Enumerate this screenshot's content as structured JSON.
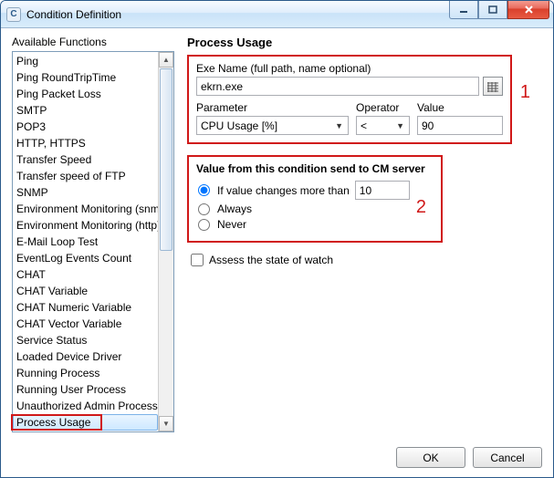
{
  "window": {
    "title": "Condition Definition",
    "icon_letter": "C"
  },
  "left": {
    "heading": "Available Functions",
    "items": [
      "Ping",
      "Ping RoundTripTime",
      "Ping Packet Loss",
      "SMTP",
      "POP3",
      "HTTP, HTTPS",
      "Transfer Speed",
      "Transfer speed of FTP",
      "SNMP",
      "Environment Monitoring (snmp)",
      "Environment Monitoring (http)",
      "E-Mail Loop Test",
      "EventLog Events Count",
      "CHAT",
      "CHAT Variable",
      "CHAT Numeric Variable",
      "CHAT Vector Variable",
      "Service Status",
      "Loaded Device Driver",
      "Running Process",
      "Running User Process",
      "Unauthorized Admin Process",
      "Process Usage"
    ],
    "selected_index": 22
  },
  "right": {
    "heading": "Process Usage",
    "box1": {
      "exe_label": "Exe Name (full path, name optional)",
      "exe_value": "ekrn.exe",
      "param_label": "Parameter",
      "param_value": "CPU Usage [%]",
      "op_label": "Operator",
      "op_value": "<",
      "value_label": "Value",
      "value_value": "90",
      "annotation": "1"
    },
    "box2": {
      "title": "Value from this condition send to CM server",
      "opt_changes": "If value changes more than",
      "changes_value": "10",
      "opt_always": "Always",
      "opt_never": "Never",
      "annotation": "2"
    },
    "assess_label": "Assess the state of watch"
  },
  "buttons": {
    "ok": "OK",
    "cancel": "Cancel"
  }
}
